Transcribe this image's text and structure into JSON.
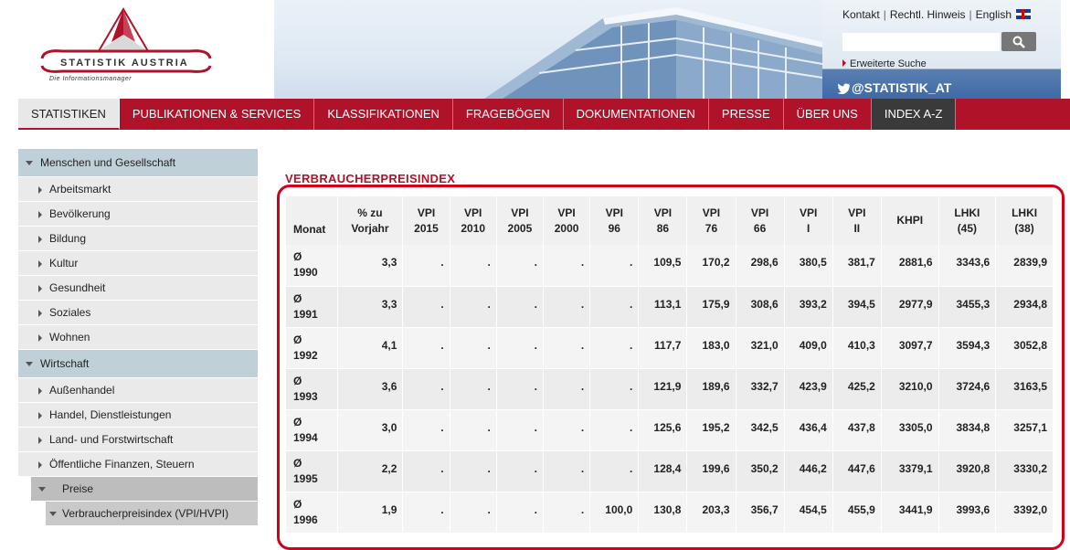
{
  "logo": {
    "name": "STATISTIK AUSTRIA",
    "tagline": "Die Informationsmanager"
  },
  "util": {
    "kontakt": "Kontakt",
    "hinweis": "Rechtl. Hinweis",
    "english": "English",
    "search_placeholder": "",
    "advanced_search": "Erweiterte Suche",
    "twitter": "@STATISTIK_AT"
  },
  "nav": [
    "STATISTIKEN",
    "PUBLIKATIONEN & SERVICES",
    "KLASSIFIKATIONEN",
    "FRAGEBÖGEN",
    "DOKUMENTATIONEN",
    "PRESSE",
    "ÜBER UNS",
    "INDEX A-Z"
  ],
  "sidebar": {
    "cat1": "Menschen und Gesellschaft",
    "cat1_items": [
      "Arbeitsmarkt",
      "Bevölkerung",
      "Bildung",
      "Kultur",
      "Gesundheit",
      "Soziales",
      "Wohnen"
    ],
    "cat2": "Wirtschaft",
    "cat2_items": [
      "Außenhandel",
      "Handel, Dienstleistungen",
      "Land- und Forstwirtschaft",
      "Öffentliche Finanzen, Steuern"
    ],
    "sub1": "Preise",
    "sub2": "Verbraucherpreisindex (VPI/HVPI)"
  },
  "main": {
    "title": "VERBRAUCHERPREISINDEX",
    "headers": [
      [
        "Monat"
      ],
      [
        "% zu",
        "Vorjahr"
      ],
      [
        "VPI",
        "2015"
      ],
      [
        "VPI",
        "2010"
      ],
      [
        "VPI",
        "2005"
      ],
      [
        "VPI",
        "2000"
      ],
      [
        "VPI",
        "96"
      ],
      [
        "VPI",
        "86"
      ],
      [
        "VPI",
        "76"
      ],
      [
        "VPI",
        "66"
      ],
      [
        "VPI",
        "I"
      ],
      [
        "VPI",
        "II"
      ],
      [
        "KHPI"
      ],
      [
        "LHKI",
        "(45)"
      ],
      [
        "LHKI",
        "(38)"
      ]
    ],
    "rows": [
      [
        "Ø",
        "1990",
        "3,3",
        ".",
        ".",
        ".",
        ".",
        ".",
        "109,5",
        "170,2",
        "298,6",
        "380,5",
        "381,7",
        "2881,6",
        "3343,6",
        "2839,9"
      ],
      [
        "Ø",
        "1991",
        "3,3",
        ".",
        ".",
        ".",
        ".",
        ".",
        "113,1",
        "175,9",
        "308,6",
        "393,2",
        "394,5",
        "2977,9",
        "3455,3",
        "2934,8"
      ],
      [
        "Ø",
        "1992",
        "4,1",
        ".",
        ".",
        ".",
        ".",
        ".",
        "117,7",
        "183,0",
        "321,0",
        "409,0",
        "410,3",
        "3097,7",
        "3594,3",
        "3052,8"
      ],
      [
        "Ø",
        "1993",
        "3,6",
        ".",
        ".",
        ".",
        ".",
        ".",
        "121,9",
        "189,6",
        "332,7",
        "423,9",
        "425,2",
        "3210,0",
        "3724,6",
        "3163,5"
      ],
      [
        "Ø",
        "1994",
        "3,0",
        ".",
        ".",
        ".",
        ".",
        ".",
        "125,6",
        "195,2",
        "342,5",
        "436,4",
        "437,8",
        "3305,0",
        "3834,8",
        "3257,1"
      ],
      [
        "Ø",
        "1995",
        "2,2",
        ".",
        ".",
        ".",
        ".",
        ".",
        "128,4",
        "199,6",
        "350,2",
        "446,2",
        "447,6",
        "3379,1",
        "3920,8",
        "3330,2"
      ],
      [
        "Ø",
        "1996",
        "1,9",
        ".",
        ".",
        ".",
        ".",
        "100,0",
        "130,8",
        "203,3",
        "356,7",
        "454,5",
        "455,9",
        "3441,9",
        "3993,6",
        "3392,0"
      ]
    ]
  }
}
